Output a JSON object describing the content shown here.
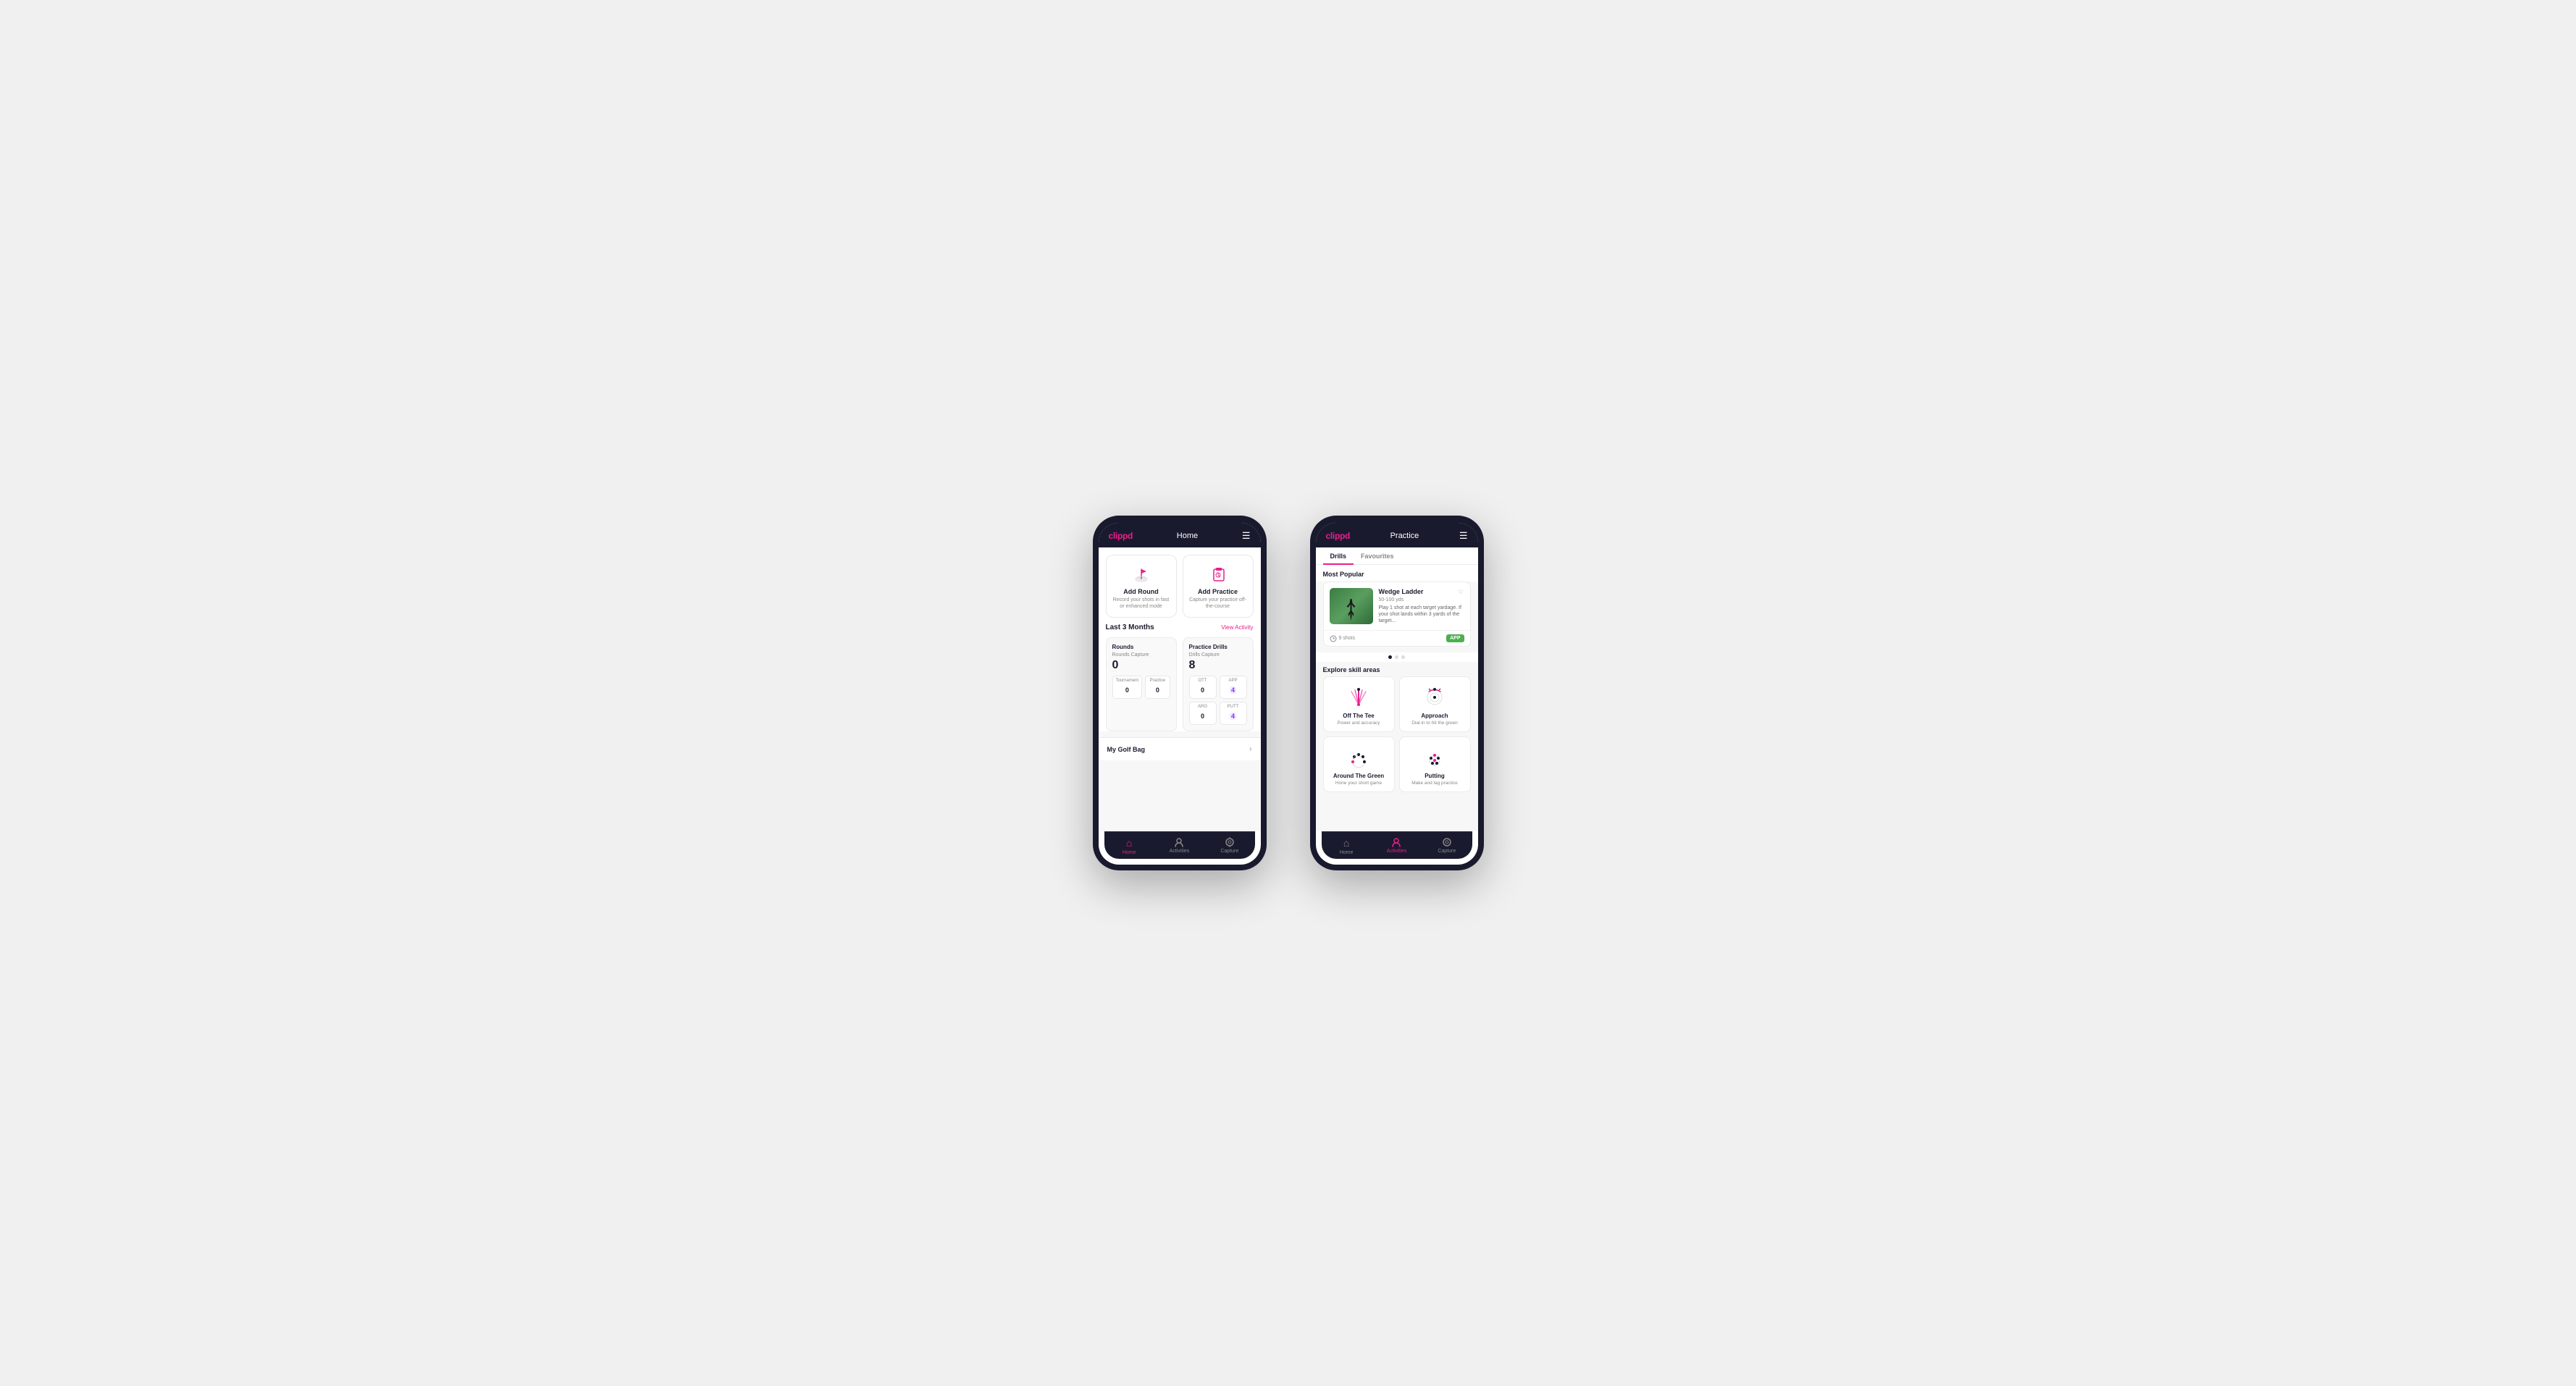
{
  "phone1": {
    "header": {
      "logo": "clippd",
      "title": "Home"
    },
    "actions": [
      {
        "id": "add-round",
        "title": "Add Round",
        "desc": "Record your shots in fast or enhanced mode",
        "icon": "flag"
      },
      {
        "id": "add-practice",
        "title": "Add Practice",
        "desc": "Capture your practice off-the-course",
        "icon": "clipboard"
      }
    ],
    "stats": {
      "period": "Last 3 Months",
      "view_activity": "View Activity",
      "rounds": {
        "title": "Rounds",
        "capture_label": "Rounds Capture",
        "value": "0",
        "sub_items": [
          {
            "label": "Tournament",
            "value": "0"
          },
          {
            "label": "Practice",
            "value": "0"
          }
        ]
      },
      "practice_drills": {
        "title": "Practice Drills",
        "capture_label": "Drills Capture",
        "value": "8",
        "sub_items": [
          {
            "label": "OTT",
            "value": "0"
          },
          {
            "label": "APP",
            "value": "4",
            "highlight": true
          },
          {
            "label": "ARG",
            "value": "0"
          },
          {
            "label": "PUTT",
            "value": "4",
            "highlight": true
          }
        ]
      }
    },
    "golf_bag": "My Golf Bag",
    "nav": [
      {
        "label": "Home",
        "active": true,
        "icon": "home"
      },
      {
        "label": "Activities",
        "active": false,
        "icon": "activities"
      },
      {
        "label": "Capture",
        "active": false,
        "icon": "capture"
      }
    ]
  },
  "phone2": {
    "header": {
      "logo": "clippd",
      "title": "Practice"
    },
    "tabs": [
      {
        "label": "Drills",
        "active": true
      },
      {
        "label": "Favourites",
        "active": false
      }
    ],
    "most_popular": "Most Popular",
    "featured_drill": {
      "title": "Wedge Ladder",
      "yardage": "50-100 yds",
      "desc": "Play 1 shot at each target yardage. If your shot lands within 3 yards of the target...",
      "shots": "9 shots",
      "badge": "APP"
    },
    "explore_title": "Explore skill areas",
    "skill_areas": [
      {
        "id": "off-the-tee",
        "name": "Off The Tee",
        "desc": "Power and accuracy",
        "icon": "tee"
      },
      {
        "id": "approach",
        "name": "Approach",
        "desc": "Dial-in to hit the green",
        "icon": "approach"
      },
      {
        "id": "around-the-green",
        "name": "Around The Green",
        "desc": "Hone your short game",
        "icon": "around-green"
      },
      {
        "id": "putting",
        "name": "Putting",
        "desc": "Make and lag practice",
        "icon": "putting"
      }
    ],
    "nav": [
      {
        "label": "Home",
        "active": false,
        "icon": "home"
      },
      {
        "label": "Activities",
        "active": true,
        "icon": "activities"
      },
      {
        "label": "Capture",
        "active": false,
        "icon": "capture"
      }
    ]
  }
}
